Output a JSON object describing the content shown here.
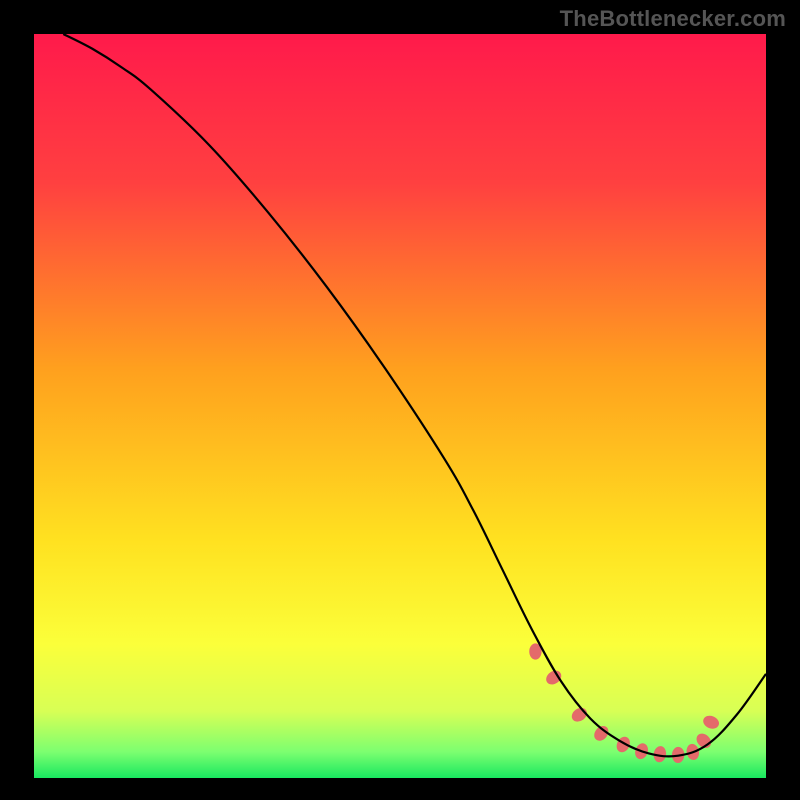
{
  "watermark": "TheBottlenecker.com",
  "chart_data": {
    "type": "line",
    "title": "",
    "xlabel": "",
    "ylabel": "",
    "xlim": [
      0,
      100
    ],
    "ylim": [
      0,
      100
    ],
    "grid": false,
    "background_gradient": {
      "stops": [
        {
          "offset": 0.0,
          "color": "#ff1a4b"
        },
        {
          "offset": 0.2,
          "color": "#ff4040"
        },
        {
          "offset": 0.45,
          "color": "#ffa01e"
        },
        {
          "offset": 0.68,
          "color": "#ffe120"
        },
        {
          "offset": 0.82,
          "color": "#fbff3a"
        },
        {
          "offset": 0.91,
          "color": "#d8ff55"
        },
        {
          "offset": 0.965,
          "color": "#7cff70"
        },
        {
          "offset": 1.0,
          "color": "#19e860"
        }
      ]
    },
    "series": [
      {
        "name": "bottleneck-curve",
        "color": "#000000",
        "stroke_width": 2.2,
        "x": [
          4,
          8,
          12,
          16,
          24,
          32,
          40,
          48,
          56,
          60,
          64,
          68,
          72,
          76,
          80,
          84,
          88,
          92,
          96,
          100
        ],
        "y": [
          100,
          98,
          95.5,
          92.5,
          85,
          76,
          66,
          55,
          43,
          36,
          28,
          20,
          13,
          8,
          5,
          3.3,
          3,
          4.5,
          8.5,
          14
        ]
      }
    ],
    "markers": {
      "name": "optimal-range-dots",
      "color": "#e46a6a",
      "border": "#b84040",
      "r": 6.5,
      "x": [
        68.5,
        71,
        74.5,
        77.5,
        80.5,
        83,
        85.5,
        88,
        90,
        91.5,
        92.5
      ],
      "y": [
        17,
        13.5,
        8.5,
        6,
        4.5,
        3.6,
        3.2,
        3.1,
        3.5,
        5,
        7.5
      ]
    }
  }
}
